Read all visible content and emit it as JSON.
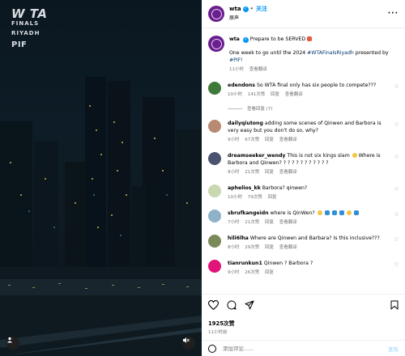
{
  "media": {
    "logo_line1": "W TA",
    "logo_line2": "FINALS",
    "logo_line3": "RIYADH",
    "logo_line4": "PIF"
  },
  "header": {
    "username": "wta",
    "follow_label": "关注",
    "subtitle": "原声"
  },
  "caption": {
    "username": "wta",
    "text": "Prepare to be SERVED",
    "line2_prefix": "One week to go until the 2024",
    "hashtag1": "#WTAFinalsRiyadh",
    "line2_mid": "presented by",
    "hashtag2": "#PIF!",
    "time": "11小时",
    "translate": "查看翻译"
  },
  "comments": [
    {
      "user": "edendons",
      "text": "So WTA final only has six people to compete???",
      "time": "10小时",
      "likes": "141次赞",
      "reply": "回复",
      "translate": "查看翻译",
      "avatar_color": "#3f7a3a"
    },
    {
      "user": "dailyqiutong",
      "text": "adding some scenes of Qinwen and Barbora is very easy but you don't do so, why?",
      "time": "9小时",
      "likes": "67次赞",
      "reply": "回复",
      "translate": "查看翻译",
      "avatar_color": "#b88a72"
    },
    {
      "user": "dreamseeker_wendy",
      "text": "This is not six kings slam",
      "text2": "Where is Barbora and Qinwen? ? ? ? ? ? ? ? ? ? ? ?",
      "time": "9小时",
      "likes": "21次赞",
      "reply": "回复",
      "translate": "查看翻译",
      "avatar_color": "#4a5470"
    },
    {
      "user": "aphelios_kk",
      "text": "Barbora?  qinwen?",
      "time": "10小时",
      "likes": "79次赞",
      "reply": "回复",
      "avatar_color": "#c9d8b0"
    },
    {
      "user": "sbrufkangeidn",
      "text": "where is QinWen?",
      "time": "7小时",
      "likes": "21次赞",
      "reply": "回复",
      "translate": "查看翻译",
      "avatar_color": "#8fb2c9"
    },
    {
      "user": "hili6lha",
      "text": "Where are Qinwen and Barbara? Is this inclusive???",
      "time": "8小时",
      "likes": "29次赞",
      "reply": "回复",
      "translate": "查看翻译",
      "avatar_color": "#7a8a5a"
    },
    {
      "user": "tianrunkun1",
      "text": "Qinwen ? Barbora ?",
      "time": "9小时",
      "likes": "26次赞",
      "reply": "回复",
      "avatar_color": "#e0157a"
    }
  ],
  "view_replies": "查看回复 (7)",
  "actions": {
    "likes": "1925次赞",
    "time": "11小时前"
  },
  "add_comment": {
    "placeholder": "添加评论......",
    "post_label": "发布"
  }
}
